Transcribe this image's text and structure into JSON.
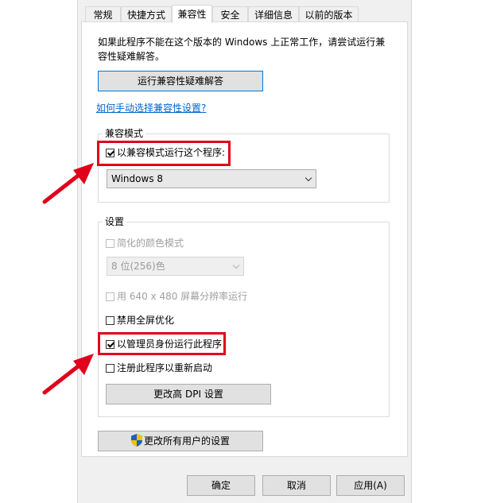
{
  "tabs": [
    {
      "label": "常规",
      "active": false
    },
    {
      "label": "快捷方式",
      "active": false
    },
    {
      "label": "兼容性",
      "active": true
    },
    {
      "label": "安全",
      "active": false
    },
    {
      "label": "详细信息",
      "active": false
    },
    {
      "label": "以前的版本",
      "active": false
    }
  ],
  "intro_text": "如果此程序不能在这个版本的 Windows 上正常工作，请尝试运行兼容性疑难解答。",
  "troubleshooter_button": "运行兼容性疑难解答",
  "manual_link": "如何手动选择兼容性设置?",
  "compat_mode": {
    "group_label": "兼容模式",
    "checkbox_label": "以兼容模式运行这个程序:",
    "checked": true,
    "selected_os": "Windows 8"
  },
  "settings": {
    "group_label": "设置",
    "reduced_color": {
      "label": "简化的颜色模式",
      "checked": false,
      "enabled": false
    },
    "color_depth": {
      "value": "8 位(256)色",
      "enabled": false
    },
    "low_res": {
      "label": "用 640 x 480 屏幕分辨率运行",
      "checked": false,
      "enabled": false
    },
    "disable_fullscreen": {
      "label": "禁用全屏优化",
      "checked": false
    },
    "run_as_admin": {
      "label": "以管理员身份运行此程序",
      "checked": true
    },
    "register_restart": {
      "label": "注册此程序以重新启动",
      "checked": false
    },
    "dpi_button": "更改高 DPI 设置"
  },
  "all_users_button": "更改所有用户的设置",
  "footer": {
    "ok": "确定",
    "cancel": "取消",
    "apply": "应用(A)"
  },
  "colors": {
    "annotation_red": "#e0001b",
    "link_blue": "#0066cc"
  }
}
